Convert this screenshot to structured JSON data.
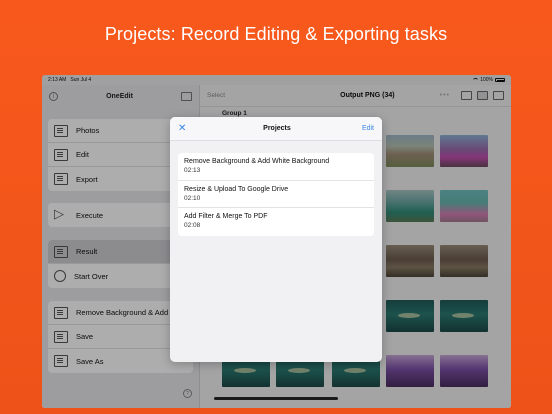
{
  "headline": "Projects: Record Editing & Exporting tasks",
  "status_bar": {
    "time": "2:13 AM",
    "date": "Sun Jul 4",
    "battery": "100%"
  },
  "sidebar": {
    "title": "OneEdit",
    "items": [
      {
        "label": "Photos",
        "icon": "photos-icon"
      },
      {
        "label": "Edit",
        "icon": "edit-icon"
      },
      {
        "label": "Export",
        "icon": "export-icon"
      },
      {
        "label": "Execute",
        "icon": "play-icon"
      },
      {
        "label": "Result",
        "icon": "result-icon"
      },
      {
        "label": "Start Over",
        "icon": "refresh-icon"
      },
      {
        "label": "Remove Background & Add White Background",
        "icon": "list-icon"
      },
      {
        "label": "Save",
        "icon": "save-icon"
      },
      {
        "label": "Save As",
        "icon": "save-as-icon"
      }
    ]
  },
  "main": {
    "select_label": "Select",
    "title": "Output PNG (34)",
    "group_label": "Group 1"
  },
  "modal": {
    "title": "Projects",
    "edit_label": "Edit",
    "close_icon": "close-icon",
    "projects": [
      {
        "name": "Remove Background & Add White Background",
        "duration": "02:13"
      },
      {
        "name": "Resize & Upload To Google Drive",
        "duration": "02:10"
      },
      {
        "name": "Add Filter & Merge To PDF",
        "duration": "02:08"
      }
    ]
  },
  "colors": {
    "background": "#f4561b",
    "accent": "#3a86e6",
    "selected_row": "#cfcfd3"
  }
}
